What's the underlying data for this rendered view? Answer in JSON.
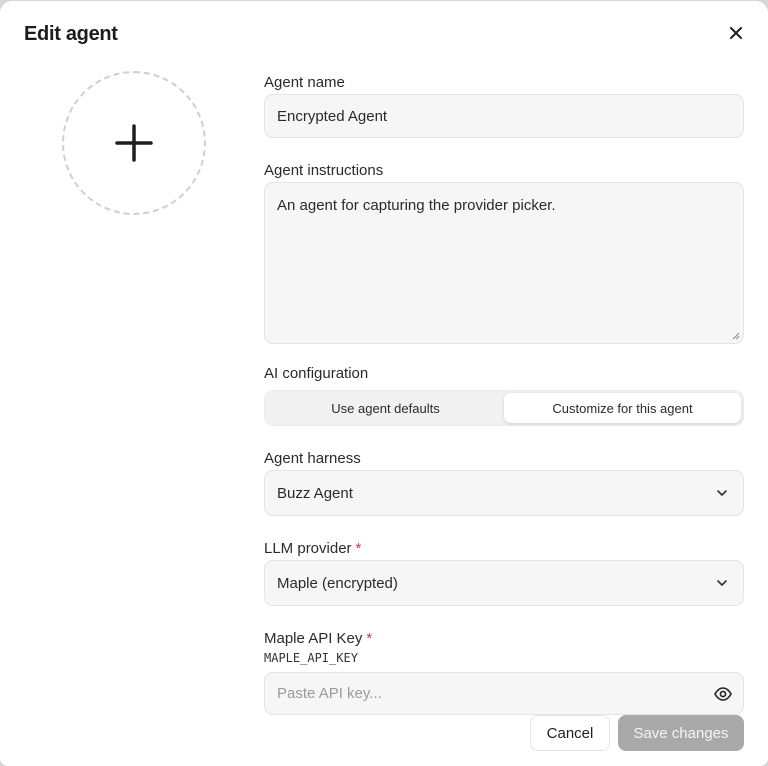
{
  "dialog": {
    "title": "Edit agent"
  },
  "form": {
    "name_label": "Agent name",
    "name_value": "Encrypted Agent",
    "instructions_label": "Agent instructions",
    "instructions_value": "An agent for capturing the provider picker.",
    "ai_config_label": "AI configuration",
    "ai_config_options": [
      "Use agent defaults",
      "Customize for this agent"
    ],
    "ai_config_selected": "Customize for this agent",
    "harness_label": "Agent harness",
    "harness_value": "Buzz Agent",
    "provider_label": "LLM provider",
    "provider_required": "*",
    "provider_value": "Maple (encrypted)",
    "apikey_label": "Maple API Key",
    "apikey_required": "*",
    "apikey_env": "MAPLE_API_KEY",
    "apikey_placeholder": "Paste API key..."
  },
  "footer": {
    "cancel_label": "Cancel",
    "save_label": "Save changes"
  },
  "icons": {
    "close": "close-icon",
    "avatar_add": "plus-icon",
    "chevron": "chevron-down-icon",
    "reveal": "eye-icon"
  },
  "colors": {
    "required": "#d93838",
    "save_disabled": "#a9a9a9"
  }
}
